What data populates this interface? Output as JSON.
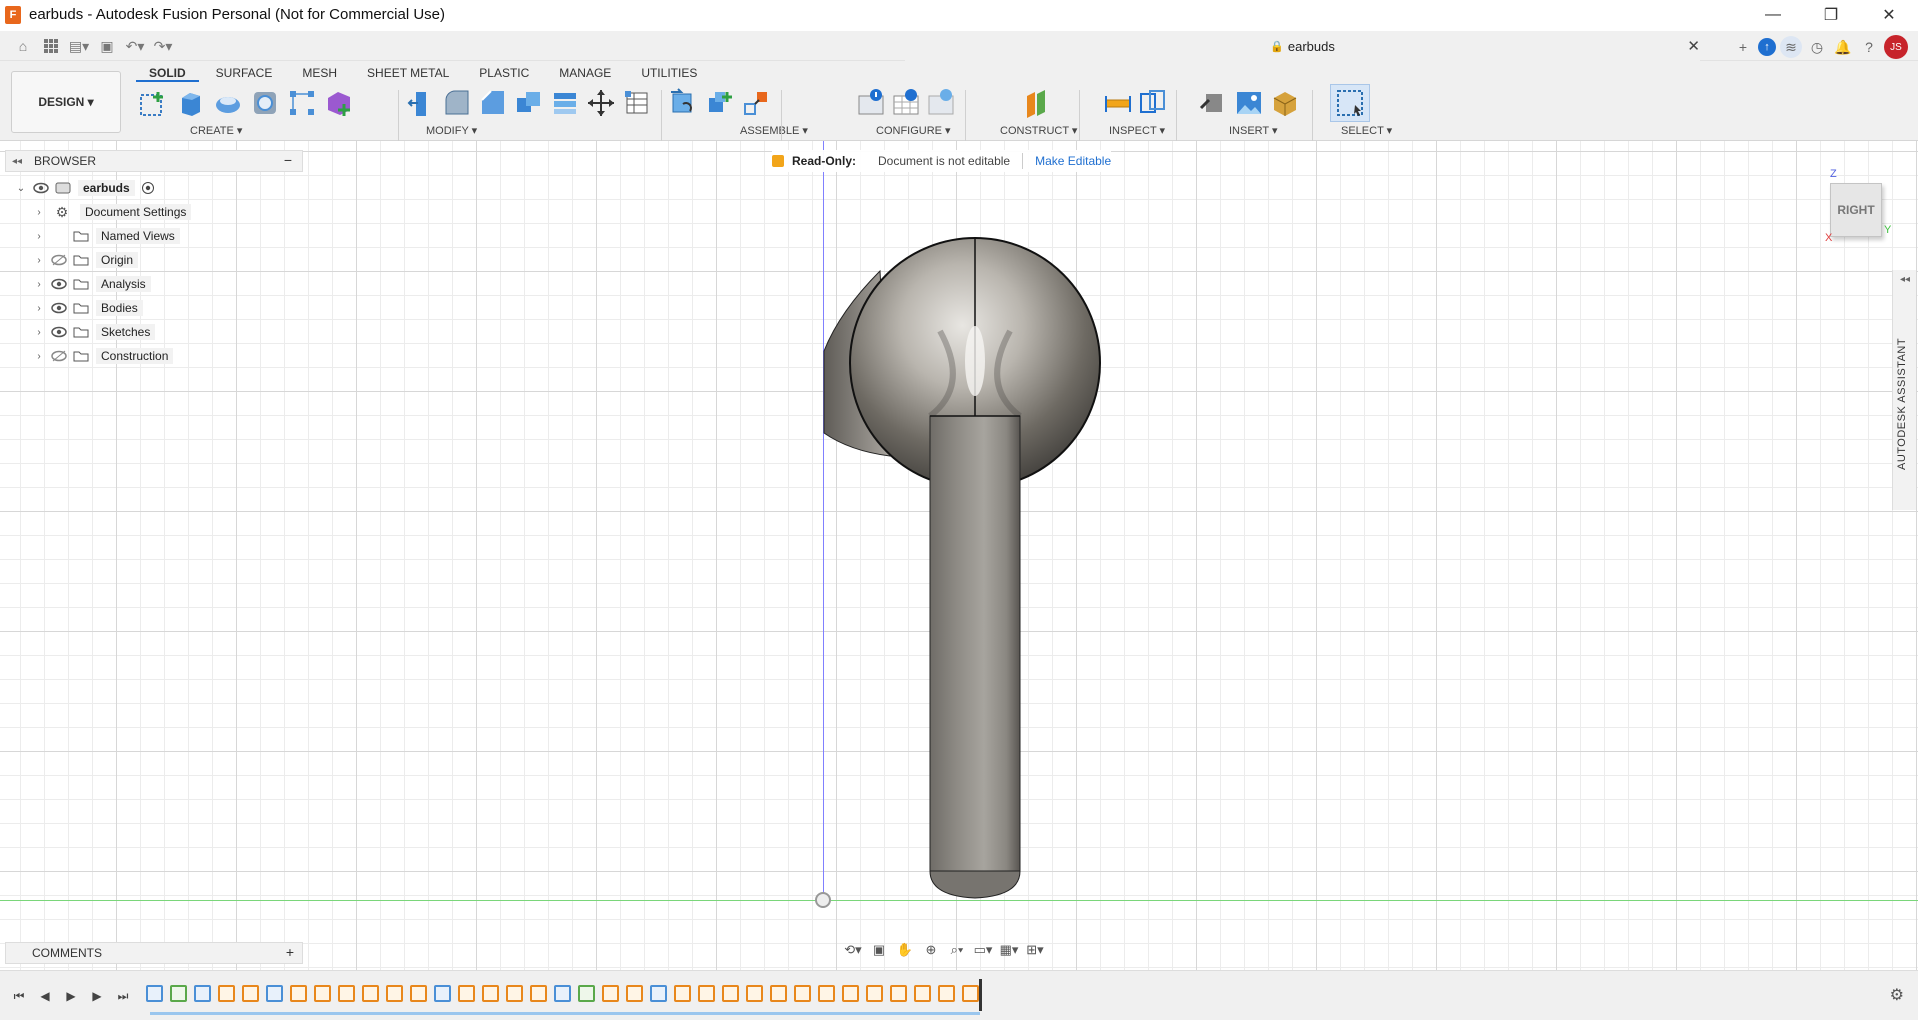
{
  "window": {
    "title": "earbuds - Autodesk Fusion Personal (Not for Commercial Use)",
    "app_logo_letter": "F",
    "minimize_label": "—",
    "restore_label": "❐",
    "close_label": "✕"
  },
  "document_tab": {
    "name": "earbuds",
    "close_label": "✕"
  },
  "user": {
    "initials": "JS"
  },
  "workspace": {
    "label": "DESIGN ▾"
  },
  "tabs": [
    "SOLID",
    "SURFACE",
    "MESH",
    "SHEET METAL",
    "PLASTIC",
    "MANAGE",
    "UTILITIES"
  ],
  "toolbar_groups": [
    "CREATE ▾",
    "MODIFY ▾",
    "ASSEMBLE ▾",
    "CONFIGURE ▾",
    "CONSTRUCT ▾",
    "INSPECT ▾",
    "INSERT ▾",
    "SELECT ▾"
  ],
  "browser": {
    "title": "BROWSER",
    "root": "earbuds",
    "items": [
      "Document Settings",
      "Named Views",
      "Origin",
      "Analysis",
      "Bodies",
      "Sketches",
      "Construction"
    ]
  },
  "readonly_bar": {
    "label": "Read-Only:",
    "message": "Document is not editable",
    "action": "Make Editable"
  },
  "view_cube": {
    "face": "RIGHT",
    "z": "Z",
    "x": "X",
    "y": "Y"
  },
  "assistant": {
    "label": "AUTODESK ASSISTANT"
  },
  "comments": {
    "title": "COMMENTS",
    "add_label": "+"
  },
  "colors": {
    "accent": "#1f6fd0",
    "avatar": "#c7242b",
    "readonly_lock": "#f2a51a",
    "timeline_feature": "#e8871c"
  }
}
